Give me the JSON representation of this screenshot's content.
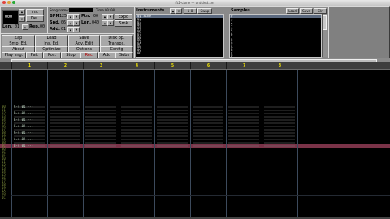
{
  "window": {
    "title": "ft2-clone — untitled.xm"
  },
  "position_panel": {
    "pos_value": "000",
    "btn_ins": "Ins.",
    "btn_del": "Del.",
    "song_len_label": "Len.",
    "song_len_value": "01",
    "repstart_label": "Rep.",
    "repstart_value": "00"
  },
  "top_labels": {
    "song_name_label": "Song name:",
    "song_name_value": "",
    "time_label": "Time",
    "time_value": "00:00"
  },
  "song_settings": {
    "bpm_label": "BPM",
    "bpm_value": "125",
    "spd_label": "Spd.",
    "spd_value": "06",
    "add_label": "Add.",
    "add_value": "01",
    "ptn_label": "Ptn.",
    "ptn_value": "00",
    "ptnlen_label": "Len.",
    "ptnlen_value": "040",
    "expand_label": "Expd",
    "shrink_label": "Srnk"
  },
  "menu_buttons": [
    [
      "Zap",
      "Load",
      "Save",
      "Disk op."
    ],
    [
      "Smp. Ed.",
      "Ins. Ed.",
      "Adv. Edit",
      "Transps."
    ],
    [
      "About",
      "Optimize",
      "Options",
      "Config"
    ],
    [
      "Play sng.",
      "Pat.",
      "Pos.",
      "Stop",
      "Rec.",
      "Add",
      "Subs"
    ]
  ],
  "instruments": {
    "title": "Instruments",
    "tab_buttons": [
      "1-8",
      "Swap"
    ],
    "items": [
      "01 Sine",
      "02",
      "03",
      "04",
      "05",
      "06",
      "07",
      "08",
      "09",
      "0A",
      "0B",
      "0C",
      "0D"
    ],
    "selected_index": 0
  },
  "samples": {
    "title": "Samples",
    "tab_buttons": [
      "Load",
      "Save",
      "Clr"
    ],
    "items": [
      "0",
      "1",
      "2",
      "3",
      "4",
      "5",
      "6",
      "7",
      "8",
      "9",
      "A",
      "B",
      "C",
      "D",
      "E"
    ],
    "selected_index": 0
  },
  "channels": [
    "1",
    "2",
    "3",
    "4",
    "5",
    "6",
    "7",
    "8"
  ],
  "pattern": {
    "rows_visible": [
      "00",
      "01",
      "02",
      "03",
      "04",
      "05",
      "06",
      "07",
      "08",
      "09",
      "0A",
      "0B",
      "0C",
      "0D",
      "0E",
      "0F",
      "10",
      "11",
      "12",
      "13",
      "14",
      "15",
      "16",
      "17",
      "18",
      "19",
      "1A",
      "1B",
      "1C"
    ],
    "current_row": "0C",
    "cursor_channel": "1",
    "notes": [
      {
        "row": "00",
        "text": "C-4 01 ---"
      },
      {
        "row": "02",
        "text": "D-4 01 ---"
      },
      {
        "row": "04",
        "text": "E-4 01 ---"
      },
      {
        "row": "06",
        "text": "F-4 01 ---"
      },
      {
        "row": "08",
        "text": "G-4 01 ---"
      },
      {
        "row": "0A",
        "text": "A-4 01 ---"
      },
      {
        "row": "0C",
        "text": "B-4 01 ---"
      }
    ]
  },
  "colors": {
    "panel": "#8a8a8a",
    "cursor": "#7a3348",
    "channel_number": "#fff000",
    "row_number": "#7f8f3c",
    "separator": "#3c4a5c"
  }
}
